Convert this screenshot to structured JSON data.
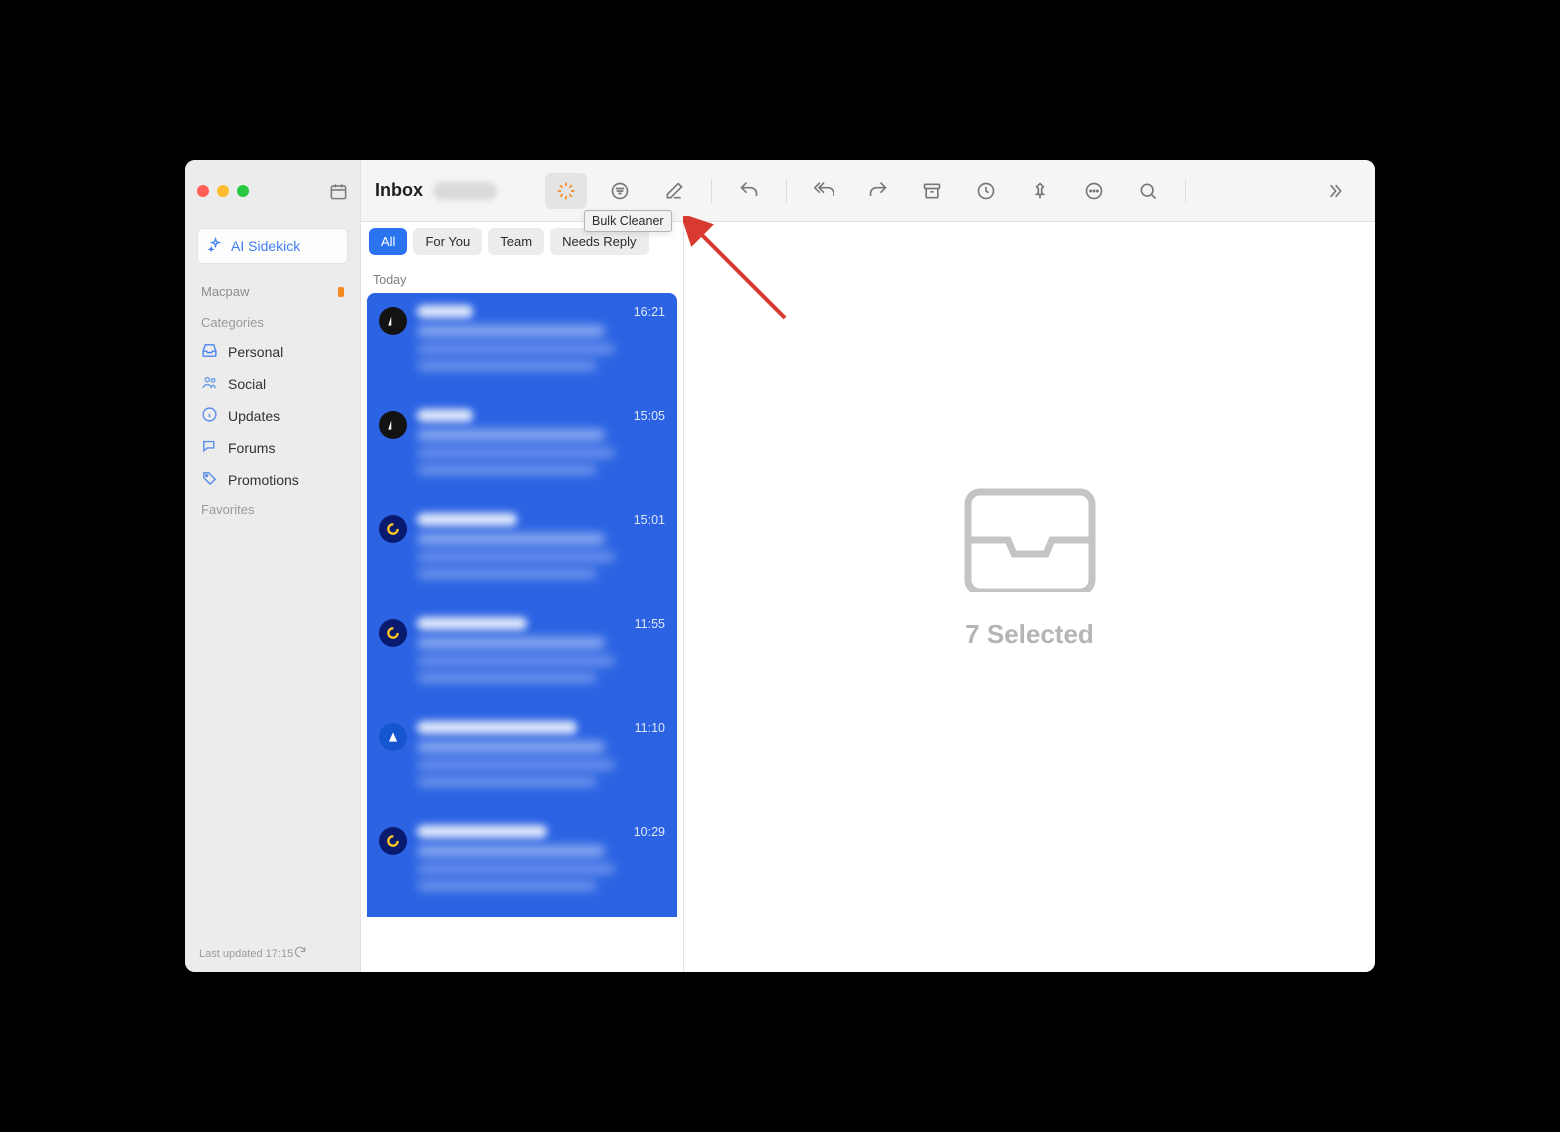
{
  "sidebar": {
    "ai_label": "AI Sidekick",
    "account_name": "Macpaw",
    "categories_title": "Categories",
    "categories": [
      {
        "label": "Personal"
      },
      {
        "label": "Social"
      },
      {
        "label": "Updates"
      },
      {
        "label": "Forums"
      },
      {
        "label": "Promotions"
      }
    ],
    "favorites_title": "Favorites",
    "footer_text": "Last updated 17:15"
  },
  "toolbar": {
    "title": "Inbox",
    "tooltip": "Bulk Cleaner"
  },
  "filters": [
    {
      "label": "All",
      "active": true
    },
    {
      "label": "For You",
      "active": false
    },
    {
      "label": "Team",
      "active": false
    },
    {
      "label": "Needs Reply",
      "active": false
    }
  ],
  "list": {
    "section": "Today",
    "items": [
      {
        "time": "16:21",
        "avatar": "black"
      },
      {
        "time": "15:05",
        "avatar": "black"
      },
      {
        "time": "15:01",
        "avatar": "blue"
      },
      {
        "time": "11:55",
        "avatar": "blue"
      },
      {
        "time": "11:10",
        "avatar": "atlas"
      },
      {
        "time": "10:29",
        "avatar": "blue"
      }
    ]
  },
  "detail": {
    "text": "7 Selected"
  }
}
